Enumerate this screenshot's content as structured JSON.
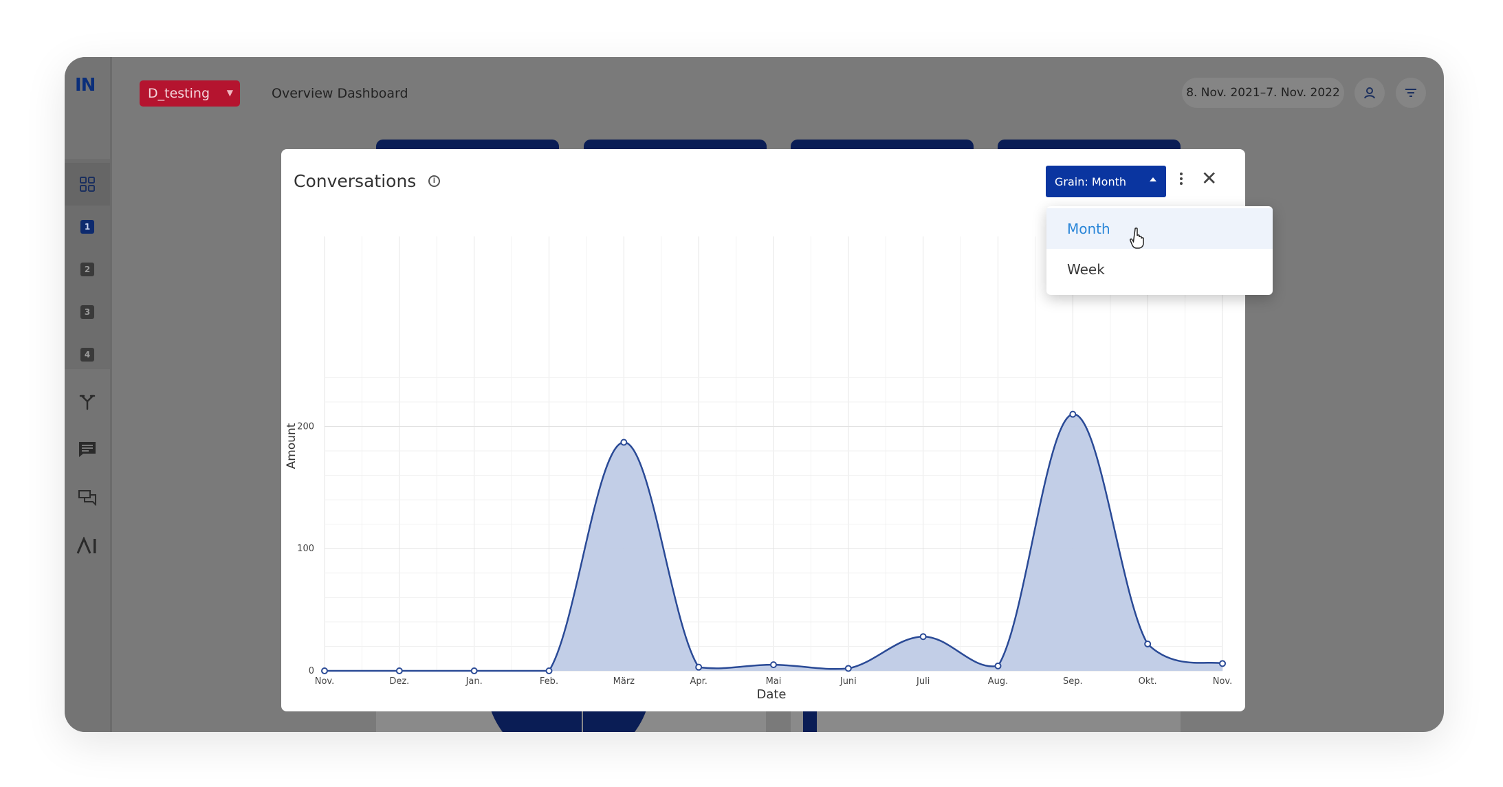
{
  "app": {
    "logo": "IN",
    "bot_tag": "D_testing",
    "page_title": "Overview Dashboard",
    "date_range": "8. Nov. 2021–7. Nov. 2022"
  },
  "sidebar": {
    "items": [
      {
        "icon": "grid-icon"
      },
      {
        "label": "1",
        "icon": "number-1-icon"
      },
      {
        "label": "2",
        "icon": "number-2-icon"
      },
      {
        "label": "3",
        "icon": "number-3-icon"
      },
      {
        "label": "4",
        "icon": "number-4-icon"
      },
      {
        "icon": "branch-icon"
      },
      {
        "icon": "chat-icon"
      },
      {
        "icon": "conversations-icon"
      },
      {
        "icon": "ai-icon",
        "label": "AI"
      }
    ]
  },
  "header_icons": [
    "user-icon",
    "filter-icon"
  ],
  "modal": {
    "title": "Conversations",
    "grain_label": "Grain: Month",
    "dropdown": {
      "options": [
        "Month",
        "Week"
      ],
      "selected": "Month"
    }
  },
  "chart_data": {
    "type": "area",
    "xlabel": "Date",
    "ylabel": "Amount",
    "categories": [
      "Nov.",
      "Dez.",
      "Jan.",
      "Feb.",
      "März",
      "Apr.",
      "Mai",
      "Juni",
      "Juli",
      "Aug.",
      "Sep.",
      "Okt.",
      "Nov."
    ],
    "values": [
      0,
      0,
      0,
      0,
      187,
      3,
      5,
      2,
      28,
      4,
      210,
      22,
      6
    ],
    "yticks": [
      0,
      100,
      200
    ],
    "ylim": [
      0,
      243
    ],
    "grid": true,
    "colors": {
      "line": "#2a4a96",
      "fill": "#bfcbe6"
    }
  }
}
